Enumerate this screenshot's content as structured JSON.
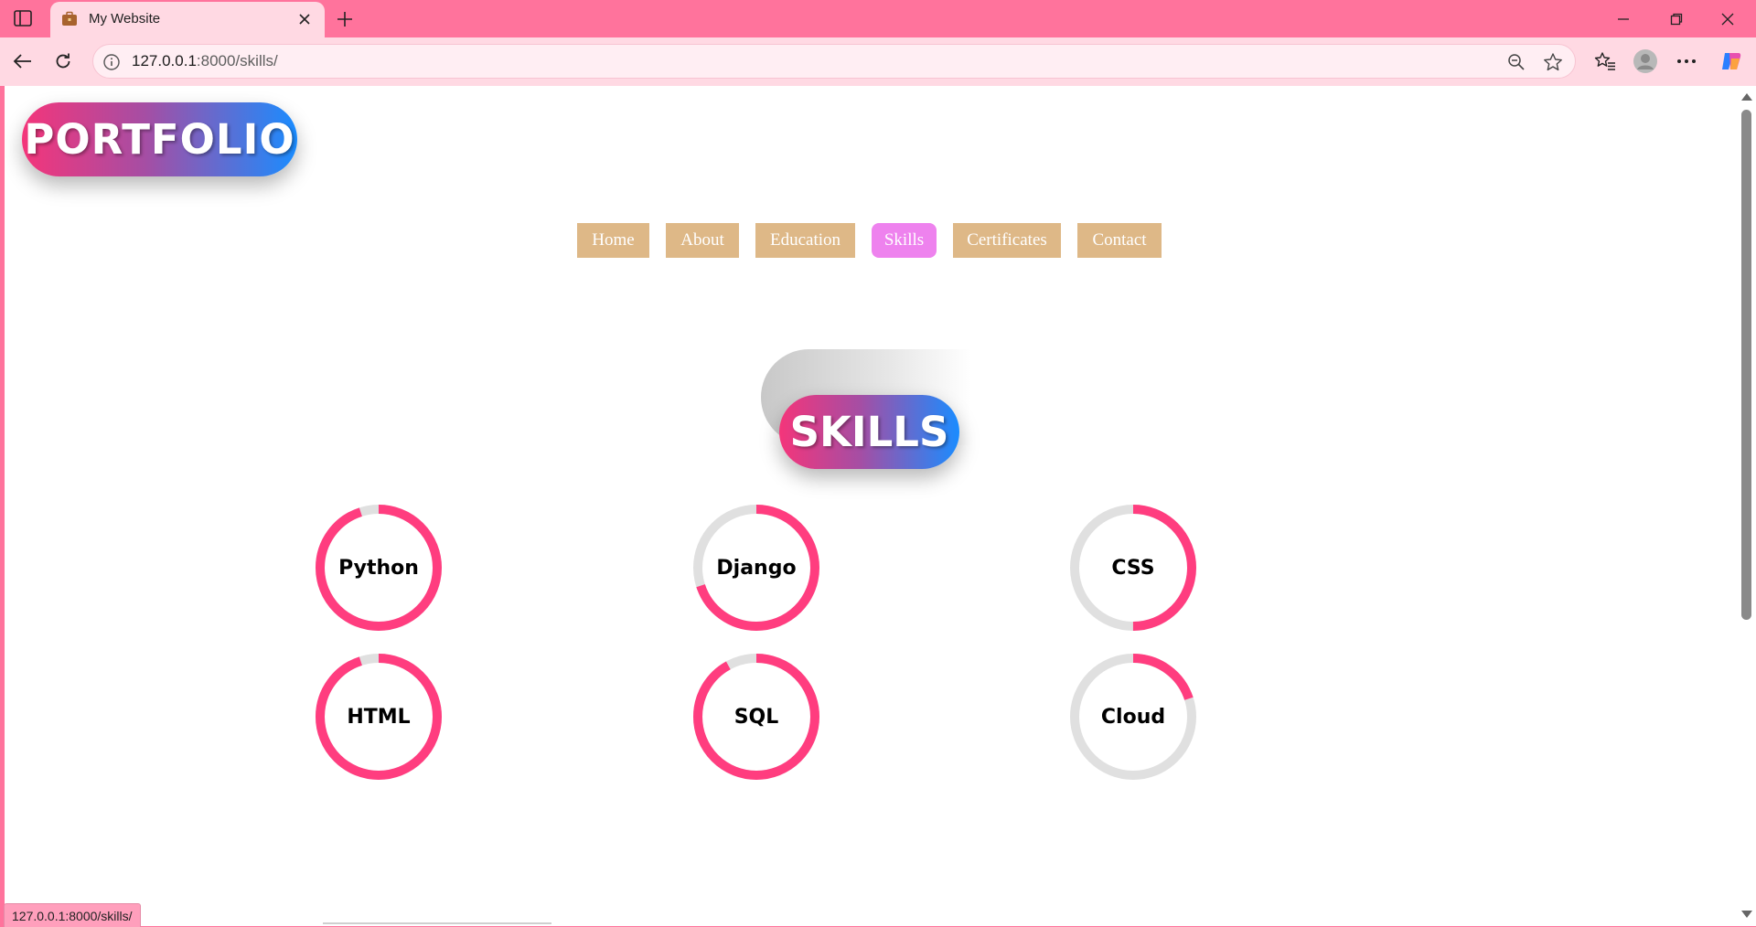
{
  "browser": {
    "tab_title": "My Website",
    "url_host": "127.0.0.1",
    "url_rest": ":8000/skills/",
    "status_url": "127.0.0.1:8000/skills/"
  },
  "colors": {
    "chrome": "#ff739c",
    "toolbar": "#ffd9e3",
    "nav_bg": "#deb887",
    "nav_active": "#ee82ee",
    "progress": "#ff3d7f",
    "track": "#e0e0e0"
  },
  "header": {
    "logo": "PORTFOLIO"
  },
  "nav": {
    "items": [
      {
        "label": "Home",
        "active": false
      },
      {
        "label": "About",
        "active": false
      },
      {
        "label": "Education",
        "active": false
      },
      {
        "label": "Skills",
        "active": true
      },
      {
        "label": "Certificates",
        "active": false
      },
      {
        "label": "Contact",
        "active": false
      }
    ]
  },
  "skills_section": {
    "title": "SKILLS",
    "skills": [
      {
        "name": "Python",
        "percent": 95
      },
      {
        "name": "Django",
        "percent": 70
      },
      {
        "name": "CSS",
        "percent": 50
      },
      {
        "name": "HTML",
        "percent": 95
      },
      {
        "name": "SQL",
        "percent": 92
      },
      {
        "name": "Cloud",
        "percent": 20
      }
    ]
  }
}
